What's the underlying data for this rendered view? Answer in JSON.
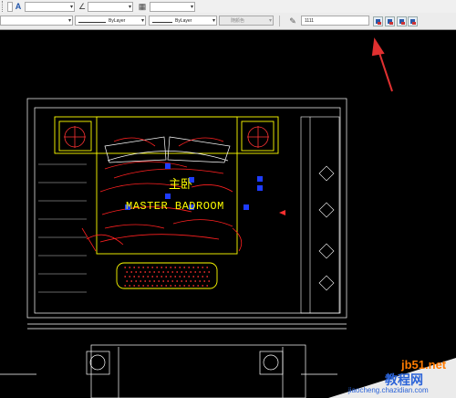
{
  "toolbar": {
    "linetype_label": "ByLayer",
    "lineweight_label": "ByLayer",
    "plotstyle_label": "随颜色",
    "text_input_value": "1111"
  },
  "drawing": {
    "title_cn": "主卧",
    "title_en": "MASTER BADROOM"
  },
  "watermark": {
    "site_cn": "教程网",
    "domain": "jb51.net",
    "url": "jiaocheng.chazidian.com"
  },
  "colors": {
    "canvas_bg": "#000000",
    "wall_lines": "#ffffff",
    "furniture": "#ffff00",
    "bedding": "#ff0000",
    "grips": "#0000ff",
    "title_text": "#ffff00",
    "annotation_arrow": "#e03030"
  }
}
